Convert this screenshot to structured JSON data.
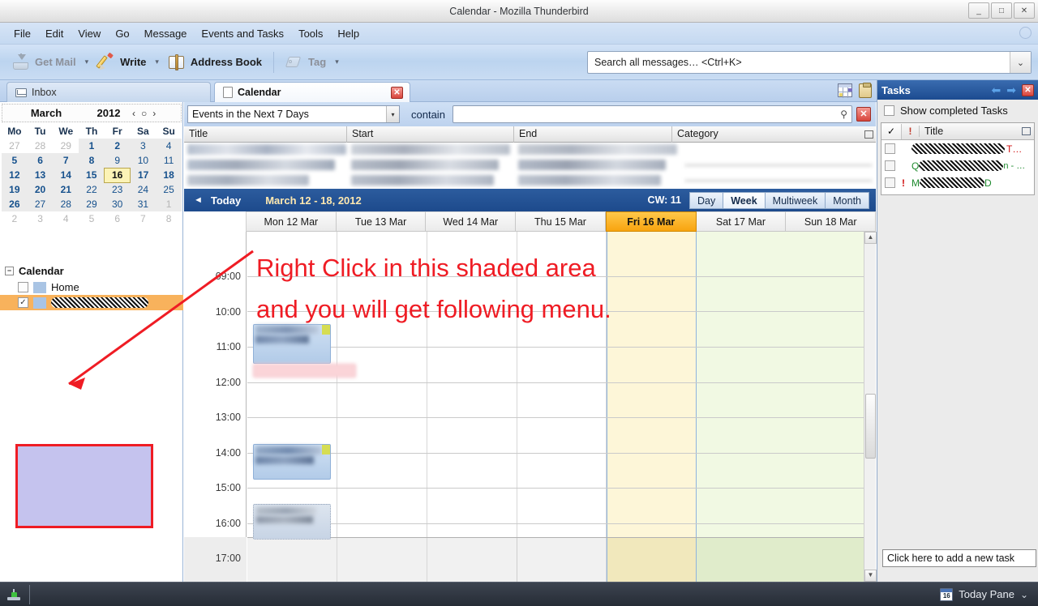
{
  "window": {
    "title": "Calendar - Mozilla Thunderbird",
    "minimize": "_",
    "maximize": "□",
    "close": "✕"
  },
  "menubar": {
    "items": [
      {
        "label": "File"
      },
      {
        "label": "Edit"
      },
      {
        "label": "View"
      },
      {
        "label": "Go"
      },
      {
        "label": "Message"
      },
      {
        "label": "Events and Tasks"
      },
      {
        "label": "Tools"
      },
      {
        "label": "Help"
      }
    ]
  },
  "toolbar": {
    "get_mail": "Get Mail",
    "write": "Write",
    "address_book": "Address Book",
    "tag": "Tag",
    "caret": "▾"
  },
  "global_search": {
    "placeholder": "Search all messages… <Ctrl+K>",
    "value": "Search all messages… <Ctrl+K>",
    "dropdown_icon": "⌄"
  },
  "tabs": [
    {
      "label": "Inbox",
      "icon": "mail-icon",
      "active": false
    },
    {
      "label": "Calendar",
      "icon": "page-icon",
      "active": true,
      "close": "✕"
    }
  ],
  "tabbar_icons": [
    "calendar-grid-icon",
    "tasks-clipboard-icon"
  ],
  "minicalendar": {
    "month": "March",
    "year": "2012",
    "nav_prev": "‹",
    "nav_today": "○",
    "nav_next": "›",
    "weekday_headers": [
      "Mo",
      "Tu",
      "We",
      "Th",
      "Fr",
      "Sa",
      "Su"
    ],
    "weeks": [
      [
        {
          "d": "27",
          "cls": "other"
        },
        {
          "d": "28",
          "cls": "other"
        },
        {
          "d": "29",
          "cls": "other"
        },
        {
          "d": "1",
          "cls": "inmonth bold shade"
        },
        {
          "d": "2",
          "cls": "inmonth bold shade"
        },
        {
          "d": "3",
          "cls": "inmonth shade"
        },
        {
          "d": "4",
          "cls": "inmonth shade"
        }
      ],
      [
        {
          "d": "5",
          "cls": "inmonth bold shade"
        },
        {
          "d": "6",
          "cls": "inmonth bold shade"
        },
        {
          "d": "7",
          "cls": "inmonth bold shade"
        },
        {
          "d": "8",
          "cls": "inmonth bold shade"
        },
        {
          "d": "9",
          "cls": "inmonth shade"
        },
        {
          "d": "10",
          "cls": "inmonth shade"
        },
        {
          "d": "11",
          "cls": "inmonth shade"
        }
      ],
      [
        {
          "d": "12",
          "cls": "inmonth bold shade"
        },
        {
          "d": "13",
          "cls": "inmonth bold shade"
        },
        {
          "d": "14",
          "cls": "inmonth bold shade"
        },
        {
          "d": "15",
          "cls": "inmonth bold shade"
        },
        {
          "d": "16",
          "cls": "today"
        },
        {
          "d": "17",
          "cls": "inmonth bold shade"
        },
        {
          "d": "18",
          "cls": "inmonth bold shade"
        }
      ],
      [
        {
          "d": "19",
          "cls": "inmonth bold shade"
        },
        {
          "d": "20",
          "cls": "inmonth bold shade"
        },
        {
          "d": "21",
          "cls": "inmonth bold shade"
        },
        {
          "d": "22",
          "cls": "inmonth shade"
        },
        {
          "d": "23",
          "cls": "inmonth shade"
        },
        {
          "d": "24",
          "cls": "inmonth shade"
        },
        {
          "d": "25",
          "cls": "inmonth shade"
        }
      ],
      [
        {
          "d": "26",
          "cls": "inmonth bold shade"
        },
        {
          "d": "27",
          "cls": "inmonth shade"
        },
        {
          "d": "28",
          "cls": "inmonth shade"
        },
        {
          "d": "29",
          "cls": "inmonth shade"
        },
        {
          "d": "30",
          "cls": "inmonth shade"
        },
        {
          "d": "31",
          "cls": "inmonth shade"
        },
        {
          "d": "1",
          "cls": "other shade"
        }
      ],
      [
        {
          "d": "2",
          "cls": "other"
        },
        {
          "d": "3",
          "cls": "other"
        },
        {
          "d": "4",
          "cls": "other"
        },
        {
          "d": "5",
          "cls": "other"
        },
        {
          "d": "6",
          "cls": "other"
        },
        {
          "d": "7",
          "cls": "other"
        },
        {
          "d": "8",
          "cls": "other"
        }
      ]
    ]
  },
  "calendar_list": {
    "header": "Calendar",
    "twisty": "−",
    "items": [
      {
        "name": "Home",
        "checked": false,
        "selected": false,
        "redacted": false
      },
      {
        "name": "",
        "checked": true,
        "selected": true,
        "redacted": true
      }
    ],
    "check_glyph": "✓"
  },
  "annotation": {
    "line1": "Right Click in this shaded area",
    "line2": "and you will get following menu.",
    "color": "#ef1c24",
    "box_fill": "#c5c3ee"
  },
  "filter_bar": {
    "selected_filter": "Events in the Next 7 Days",
    "contain_label": "contain",
    "search_value": "",
    "search_placeholder": "",
    "magnifier_icon": "⚲",
    "clear_icon": "✕",
    "dropdown_icon": "▾"
  },
  "event_list": {
    "columns": [
      "Title",
      "Start",
      "End",
      "Category"
    ],
    "rows_redacted": 3
  },
  "calnav": {
    "prev_icon": "◄",
    "today_label": "Today",
    "range": "March 12 - 18, 2012",
    "cw_label": "CW: 11",
    "views": [
      {
        "label": "Day",
        "selected": false
      },
      {
        "label": "Week",
        "selected": true
      },
      {
        "label": "Multiweek",
        "selected": false
      },
      {
        "label": "Month",
        "selected": false
      }
    ]
  },
  "week_grid": {
    "day_headers": [
      {
        "label": "Mon 12 Mar",
        "today": false,
        "weekend": false
      },
      {
        "label": "Tue 13 Mar",
        "today": false,
        "weekend": false
      },
      {
        "label": "Wed 14 Mar",
        "today": false,
        "weekend": false
      },
      {
        "label": "Thu 15 Mar",
        "today": false,
        "weekend": false
      },
      {
        "label": "Fri 16 Mar",
        "today": true,
        "weekend": false
      },
      {
        "label": "Sat 17 Mar",
        "today": false,
        "weekend": true
      },
      {
        "label": "Sun 18 Mar",
        "today": false,
        "weekend": true
      }
    ],
    "hour_labels": [
      "09:00",
      "10:00",
      "11:00",
      "12:00",
      "13:00",
      "14:00",
      "15:00",
      "16:00",
      "17:00"
    ],
    "events_redacted": 4
  },
  "tasks_pane": {
    "title": "Tasks",
    "back_icon": "⬅",
    "forward_icon": "➡",
    "close_icon": "✕",
    "show_completed_label": "Show completed Tasks",
    "show_completed_checked": false,
    "columns": {
      "done": "✓",
      "priority": "!",
      "title": "Title"
    },
    "rows": [
      {
        "checked": false,
        "priority": "",
        "redacted": true,
        "suffix": "T…",
        "suffix_color": "#d01010"
      },
      {
        "checked": false,
        "priority": "",
        "redacted": true,
        "prefix": "Q",
        "suffix": "n - …",
        "suffix_color": "#1f8b2f"
      },
      {
        "checked": false,
        "priority": "!",
        "redacted": true,
        "prefix": "M",
        "suffix": "D",
        "suffix_color": "#1f8b2f"
      }
    ],
    "new_task_placeholder": "Click here to add a new task"
  },
  "statusbar": {
    "today_pane_label": "Today Pane",
    "today_pane_date": "16",
    "chevron": "⌄"
  }
}
